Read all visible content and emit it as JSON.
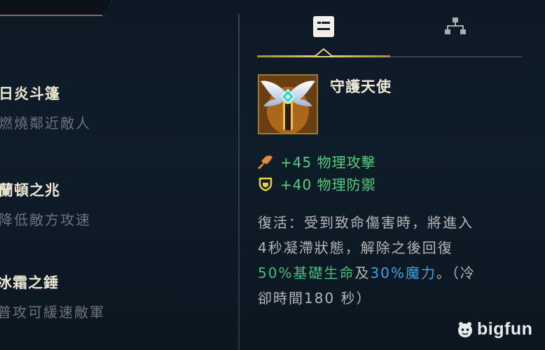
{
  "left_list": {
    "items": [
      {
        "name": "日炎斗篷",
        "desc": "燃燒鄰近敵人"
      },
      {
        "name": "蘭頓之兆",
        "desc": "降低敵方攻速"
      },
      {
        "name": "冰霜之錘",
        "desc": "普攻可緩速敵軍"
      }
    ]
  },
  "tabs": [
    {
      "icon": "details-card-icon",
      "active": true
    },
    {
      "icon": "build-tree-icon",
      "active": false
    }
  ],
  "item": {
    "title": "守護天使",
    "stats": [
      {
        "icon": "attack-damage-icon",
        "value": "+45 物理攻擊",
        "color": "#e8893a"
      },
      {
        "icon": "armor-shield-icon",
        "value": "+40 物理防禦",
        "color": "#e8d23a"
      }
    ],
    "description": {
      "line1": "復活：受到致命傷害時，將進入",
      "line2": "4秒凝滯狀態，解除之後回復",
      "line3_hl1": "50%基礎生命",
      "line3_mid": "及",
      "line3_hl2": "30%魔力",
      "line3_tail": "。（冷",
      "line4": "卻時間180 秒）"
    }
  },
  "watermark": {
    "text": "bigfun"
  },
  "colors": {
    "accent_gold": "#c9a85a",
    "stat_green": "#4fd07a",
    "highlight_blue": "#3aa5e8"
  }
}
